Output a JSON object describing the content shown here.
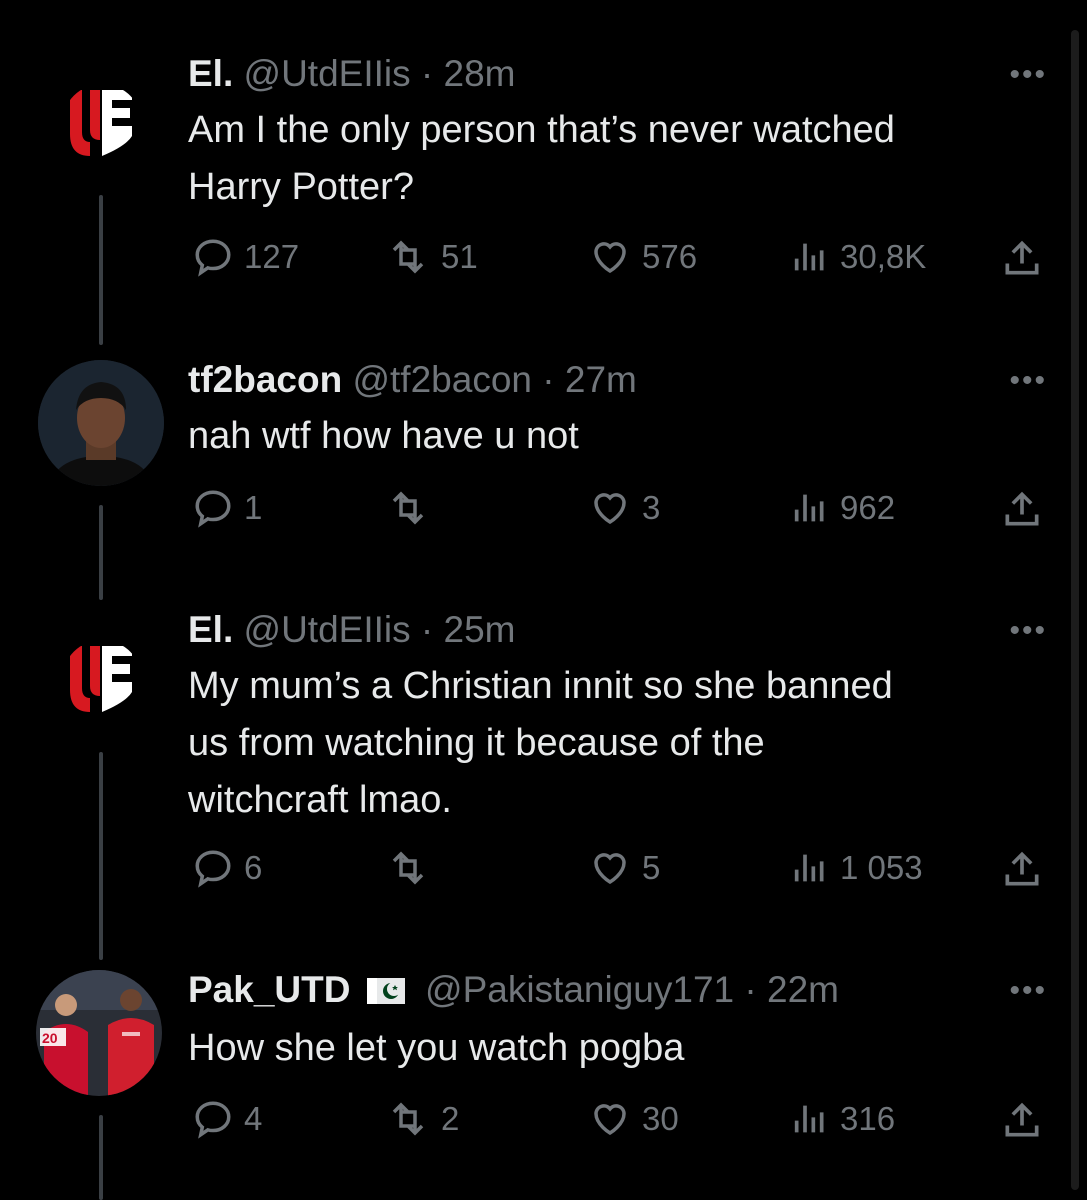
{
  "tweets": [
    {
      "name": "El.",
      "handle": "@UtdEIIis",
      "sep": "·",
      "time": "28m",
      "text_lines": [
        "Am I the only person that’s never watched",
        "Harry Potter?"
      ],
      "replies": "127",
      "retweets": "51",
      "likes": "576",
      "views": "30,8K",
      "avatar": "ue-logo"
    },
    {
      "name": "tf2bacon",
      "handle": "@tf2bacon",
      "sep": "·",
      "time": "27m",
      "text_lines": [
        "nah wtf how have u not"
      ],
      "replies": "1",
      "retweets": "",
      "likes": "3",
      "views": "962",
      "avatar": "player-photo"
    },
    {
      "name": "El.",
      "handle": "@UtdEIIis",
      "sep": "·",
      "time": "25m",
      "text_lines": [
        "My mum’s a Christian innit so she banned",
        "us from watching it because of the",
        "witchcraft lmao."
      ],
      "replies": "6",
      "retweets": "",
      "likes": "5",
      "views": "1 053",
      "avatar": "ue-logo"
    },
    {
      "name": "Pak_UTD",
      "handle": "@Pakistaniguy171",
      "sep": "·",
      "time": "22m",
      "text_lines": [
        "How she let you watch pogba"
      ],
      "replies": "4",
      "retweets": "2",
      "likes": "30",
      "views": "316",
      "avatar": "team-photo",
      "avatar_badge": "20"
    }
  ],
  "colors": {
    "background": "#000000",
    "text": "#e7e9ea",
    "muted": "#71767b",
    "logo_red": "#d71920"
  },
  "icons": [
    "reply-icon",
    "retweet-icon",
    "like-icon",
    "views-icon",
    "share-icon",
    "more-icon",
    "pakistan-flag-icon"
  ]
}
